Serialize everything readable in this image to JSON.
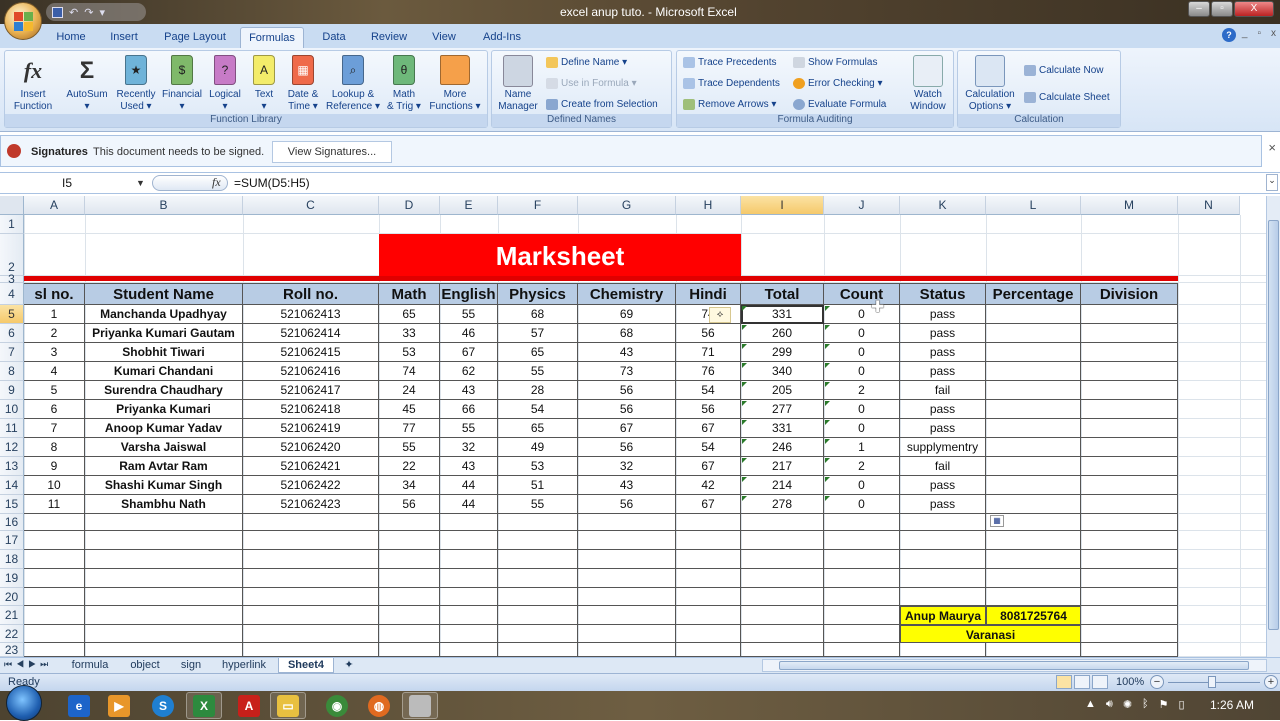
{
  "window": {
    "title": "excel anup tuto. - Microsoft Excel",
    "controls": {
      "minimize": "–",
      "restore": "▫",
      "close": "X"
    }
  },
  "ribbon_tabs": [
    {
      "label": "Home"
    },
    {
      "label": "Insert"
    },
    {
      "label": "Page Layout"
    },
    {
      "label": "Formulas",
      "active": true
    },
    {
      "label": "Data"
    },
    {
      "label": "Review"
    },
    {
      "label": "View"
    },
    {
      "label": "Add-Ins"
    }
  ],
  "ribbon": {
    "function_library": {
      "label": "Function Library",
      "buttons": [
        {
          "label1": "Insert",
          "label2": "Function",
          "icon": "fx"
        },
        {
          "label1": "AutoSum",
          "label2": "▾",
          "icon": "Σ"
        },
        {
          "label1": "Recently",
          "label2": "Used ▾",
          "icon": "★"
        },
        {
          "label1": "Financial",
          "label2": "▾",
          "icon": "$"
        },
        {
          "label1": "Logical",
          "label2": "▾",
          "icon": "?"
        },
        {
          "label1": "Text",
          "label2": "▾",
          "icon": "A"
        },
        {
          "label1": "Date &",
          "label2": "Time ▾",
          "icon": "▦"
        },
        {
          "label1": "Lookup &",
          "label2": "Reference ▾",
          "icon": "⌕"
        },
        {
          "label1": "Math",
          "label2": "& Trig ▾",
          "icon": "θ"
        },
        {
          "label1": "More",
          "label2": "Functions ▾",
          "icon": ""
        }
      ]
    },
    "defined_names": {
      "label": "Defined Names",
      "name_manager": {
        "label1": "Name",
        "label2": "Manager"
      },
      "define_name": "Define Name ▾",
      "use_in_formula": "Use in Formula ▾",
      "create_from_selection": "Create from Selection"
    },
    "formula_auditing": {
      "label": "Formula Auditing",
      "trace_precedents": "Trace Precedents",
      "trace_dependents": "Trace Dependents",
      "remove_arrows": "Remove Arrows ▾",
      "show_formulas": "Show Formulas",
      "error_checking": "Error Checking ▾",
      "evaluate_formula": "Evaluate Formula",
      "watch_window": {
        "label1": "Watch",
        "label2": "Window"
      }
    },
    "calculation": {
      "label": "Calculation",
      "options": {
        "label1": "Calculation",
        "label2": "Options ▾"
      },
      "calculate_now": "Calculate Now",
      "calculate_sheet": "Calculate Sheet"
    }
  },
  "message_bar": {
    "title": "Signatures",
    "text": "This document needs to be signed.",
    "button": "View Signatures..."
  },
  "formula_bar": {
    "name_box": "I5",
    "fx": "fx",
    "formula": "=SUM(D5:H5)"
  },
  "columns": [
    "A",
    "B",
    "C",
    "D",
    "E",
    "F",
    "G",
    "H",
    "I",
    "J",
    "K",
    "L",
    "M",
    "N"
  ],
  "selected_column": "I",
  "rows_visible": [
    "1",
    "2",
    "3",
    "4",
    "5",
    "6",
    "7",
    "8",
    "9",
    "10",
    "11",
    "12",
    "13",
    "14",
    "15",
    "16",
    "17",
    "18",
    "19",
    "20",
    "21",
    "22",
    "23"
  ],
  "selected_row": "5",
  "sheet": {
    "title": "Marksheet",
    "headers": [
      "sl no.",
      "Student Name",
      "Roll no.",
      "Math",
      "English",
      "Physics",
      "Chemistry",
      "Hindi",
      "Total",
      "Count",
      "Status",
      "Percentage",
      "Division"
    ],
    "rows": [
      [
        "1",
        "Manchanda Upadhyay",
        "521062413",
        "65",
        "55",
        "68",
        "69",
        "74",
        "331",
        "0",
        "pass",
        "",
        ""
      ],
      [
        "2",
        "Priyanka Kumari Gautam",
        "521062414",
        "33",
        "46",
        "57",
        "68",
        "56",
        "260",
        "0",
        "pass",
        "",
        ""
      ],
      [
        "3",
        "Shobhit Tiwari",
        "521062415",
        "53",
        "67",
        "65",
        "43",
        "71",
        "299",
        "0",
        "pass",
        "",
        ""
      ],
      [
        "4",
        "Kumari Chandani",
        "521062416",
        "74",
        "62",
        "55",
        "73",
        "76",
        "340",
        "0",
        "pass",
        "",
        ""
      ],
      [
        "5",
        "Surendra Chaudhary",
        "521062417",
        "24",
        "43",
        "28",
        "56",
        "54",
        "205",
        "2",
        "fail",
        "",
        ""
      ],
      [
        "6",
        "Priyanka Kumari",
        "521062418",
        "45",
        "66",
        "54",
        "56",
        "56",
        "277",
        "0",
        "pass",
        "",
        ""
      ],
      [
        "7",
        "Anoop Kumar Yadav",
        "521062419",
        "77",
        "55",
        "65",
        "67",
        "67",
        "331",
        "0",
        "pass",
        "",
        ""
      ],
      [
        "8",
        "Varsha Jaiswal",
        "521062420",
        "55",
        "32",
        "49",
        "56",
        "54",
        "246",
        "1",
        "supplymentry",
        "",
        ""
      ],
      [
        "9",
        "Ram Avtar Ram",
        "521062421",
        "22",
        "43",
        "53",
        "32",
        "67",
        "217",
        "2",
        "fail",
        "",
        ""
      ],
      [
        "10",
        "Shashi Kumar Singh",
        "521062422",
        "34",
        "44",
        "51",
        "43",
        "42",
        "214",
        "0",
        "pass",
        "",
        ""
      ],
      [
        "11",
        "Shambhu Nath",
        "521062423",
        "56",
        "44",
        "55",
        "56",
        "67",
        "278",
        "0",
        "pass",
        "",
        ""
      ]
    ],
    "footer": {
      "name": "Anup Maurya",
      "phone": "8081725764",
      "city": "Varanasi"
    },
    "colors": {
      "banner": "#ff0000",
      "header_fill": "#b8cce4",
      "footer_fill": "#ffff00"
    }
  },
  "sheet_tabs": [
    {
      "label": "formula"
    },
    {
      "label": "object"
    },
    {
      "label": "sign"
    },
    {
      "label": "hyperlink"
    },
    {
      "label": "Sheet4",
      "active": true
    }
  ],
  "status_bar": {
    "status": "Ready",
    "zoom": "100%"
  },
  "taskbar": {
    "clock": "1:26 AM"
  }
}
